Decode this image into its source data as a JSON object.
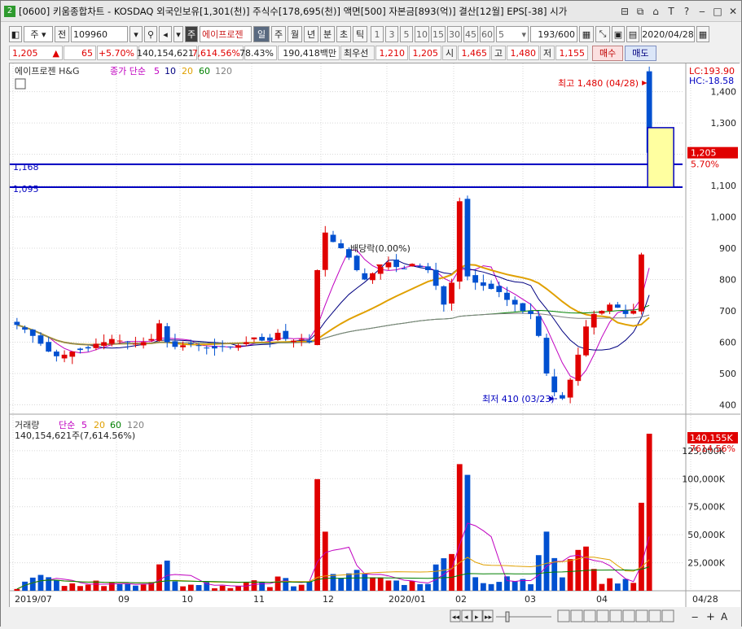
{
  "window": {
    "title": "[0600] 키움종합차트 - KOSDAQ 외국인보유[1,301(천)] 주식수[178,695(천)] 액면[500] 자본금[893(억)] 결산[12월] EPS[-38] 시가",
    "badge": "2"
  },
  "toolbar": {
    "period_type": "주",
    "prev": "전",
    "code": "109960",
    "name": "에이프로젠",
    "name_tag": "주",
    "periods": [
      "일",
      "주",
      "월",
      "년",
      "분",
      "초",
      "틱"
    ],
    "active_period": "일",
    "minutes": [
      "1",
      "3",
      "5",
      "10",
      "15",
      "30",
      "45",
      "60"
    ],
    "minute_select": "5",
    "count": "193/600",
    "date": "2020/04/28"
  },
  "quote": {
    "price": "1,205",
    "arrow": "▲",
    "change": "65",
    "change_pct": "+5.70%",
    "volume": "140,154,621",
    "vol_pct": "7,614.56%",
    "turnover": "78.43%",
    "amount": "190,418백만",
    "best_label": "최우선",
    "best_ask": "1,210",
    "best_bid": "1,205",
    "open_label": "시",
    "open": "1,465",
    "high_label": "고",
    "high": "1,480",
    "low_label": "저",
    "low": "1,155",
    "buy": "매수",
    "sell": "매도"
  },
  "price_legend": {
    "name": "에이프로젠 H&G",
    "ma_label": "종가 단순",
    "ma": [
      "5",
      "10",
      "20",
      "60",
      "120"
    ]
  },
  "volume_legend": {
    "name": "거래량",
    "ma_label": "단순",
    "ma": [
      "5",
      "20",
      "60",
      "120"
    ],
    "current": "140,154,621주(7,614.56%)"
  },
  "annotations": {
    "high": "최고 1,480 (04/28)",
    "low": "최저 410 (03/23)",
    "event": "배당락(0.00%)",
    "lc": "LC:193.90",
    "hc": "HC:-18.58",
    "hline1": "1,168",
    "hline2": "1,095",
    "price_tag": "1,205",
    "pct_tag": "5.70%",
    "vol_tag": "140,155K",
    "vol_pct_tag": "7614.56%"
  },
  "colors": {
    "up": "#e00000",
    "down": "#0050d0",
    "ma5": "#c000c0",
    "ma10": "#000080",
    "ma20": "#e0a000",
    "ma60": "#008000",
    "ma120": "#808080",
    "hline": "#0000c0"
  },
  "chart_data": [
    {
      "type": "candlestick",
      "title": "에이프로젠 H&G",
      "y_ticks": [
        400,
        500,
        600,
        700,
        800,
        900,
        1000,
        1100,
        1200,
        1300,
        1400
      ],
      "ylim": [
        370,
        1490
      ],
      "x_ticks": [
        "2019/07",
        "09",
        "10",
        "11",
        "12",
        "2020/01",
        "02",
        "03",
        "04",
        "04/28"
      ],
      "horizontal_lines": [
        1168,
        1095
      ],
      "ohlc_summary": {
        "last_close": 1205,
        "high": 1480,
        "low": 410,
        "last_open": 1465,
        "last_low": 1155
      },
      "closes": [
        655,
        640,
        620,
        595,
        570,
        555,
        560,
        570,
        575,
        580,
        595,
        600,
        610,
        605,
        600,
        595,
        600,
        610,
        660,
        600,
        585,
        590,
        595,
        590,
        580,
        580,
        585,
        585,
        590,
        600,
        615,
        605,
        605,
        630,
        610,
        605,
        610,
        600,
        830,
        950,
        920,
        900,
        870,
        830,
        800,
        820,
        840,
        855,
        840,
        835,
        850,
        840,
        830,
        780,
        720,
        790,
        1050,
        810,
        790,
        780,
        770,
        760,
        735,
        720,
        700,
        690,
        620,
        500,
        440,
        420,
        480,
        560,
        650,
        690,
        700,
        720,
        710,
        690,
        700,
        880,
        1205
      ]
    },
    {
      "type": "bar",
      "title": "거래량",
      "y_ticks": [
        "25,000K",
        "50,000K",
        "75,000K",
        "100,000K",
        "125,000K"
      ],
      "ylim": [
        0,
        140155
      ],
      "note": "volume in thousands of shares"
    }
  ]
}
